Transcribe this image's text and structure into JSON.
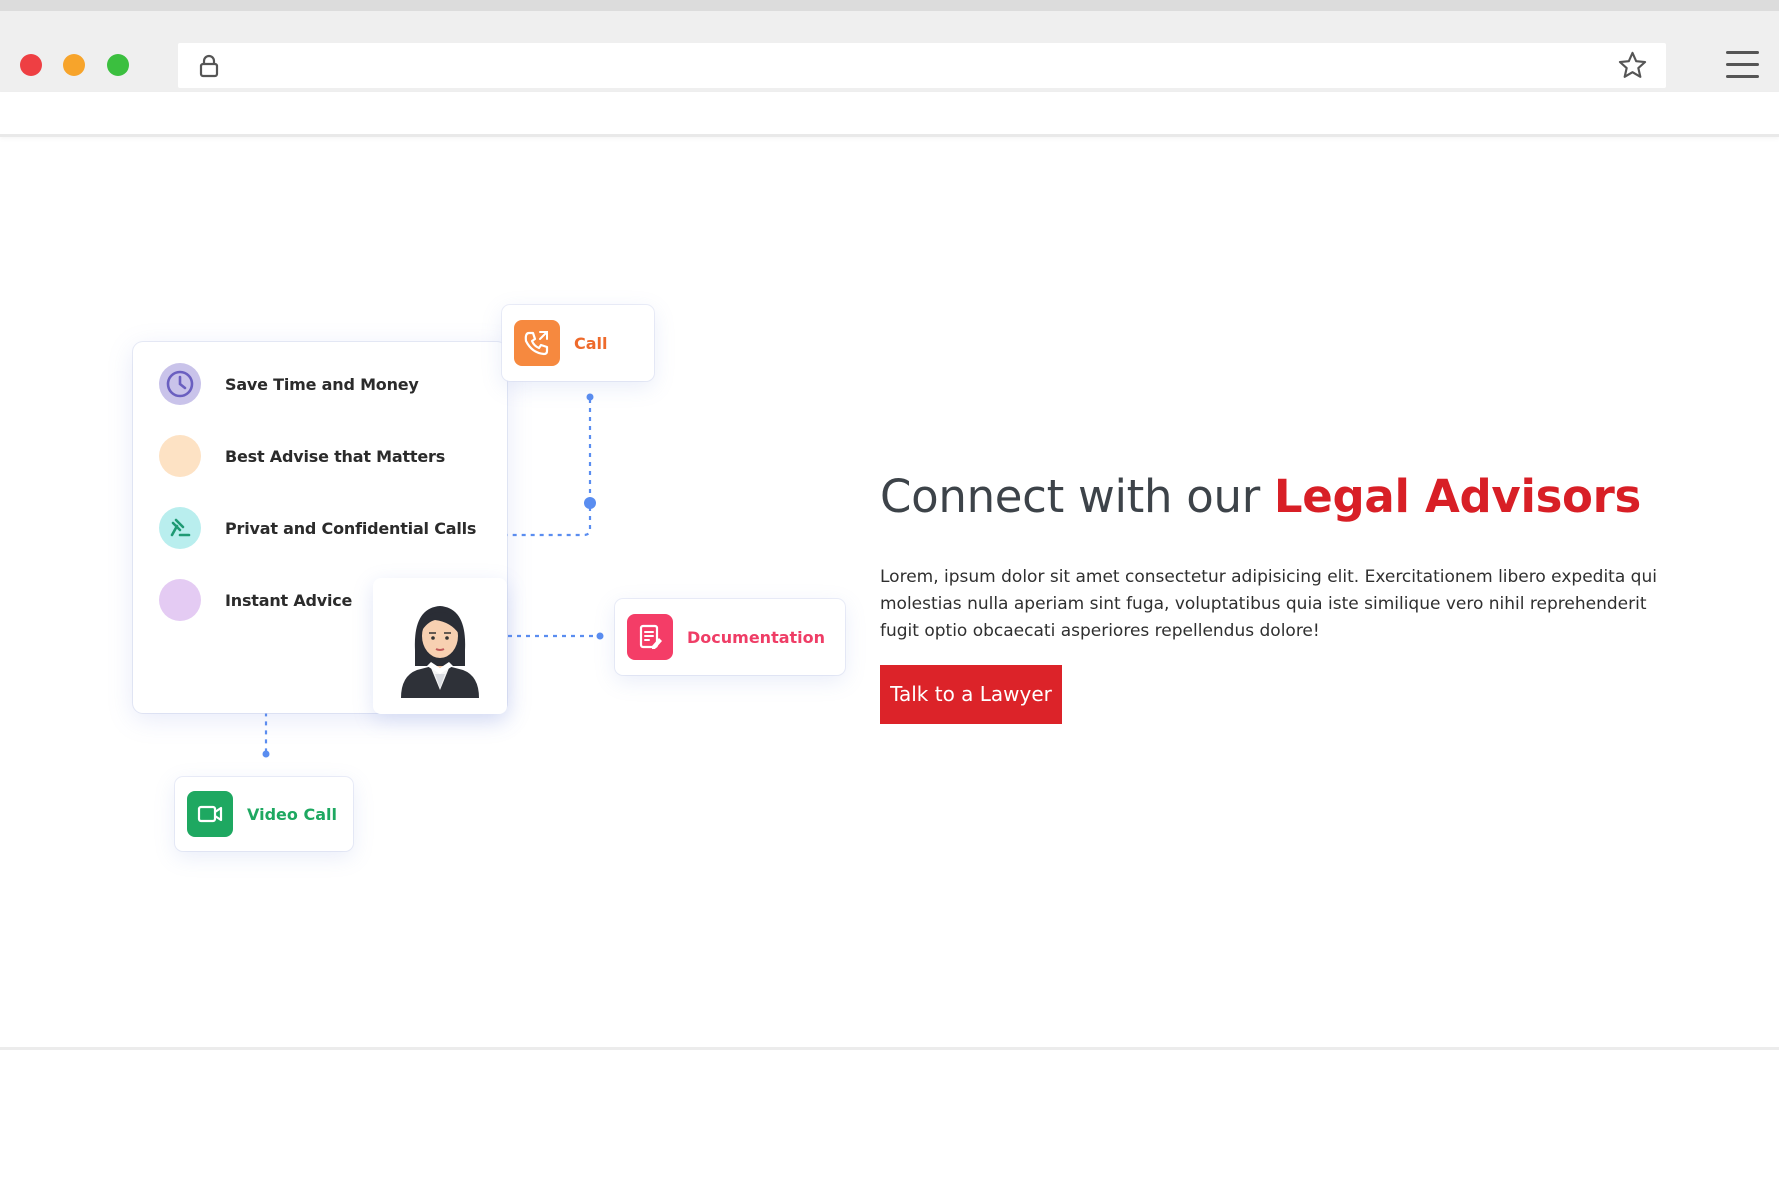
{
  "browser": {
    "url": "",
    "lock_icon": "lock-icon",
    "bookmark_icon": "star-icon",
    "menu_icon": "hamburger-menu-icon"
  },
  "features": [
    {
      "label": "Save Time and Money",
      "icon": "clock-icon",
      "color": "#c9c3ea"
    },
    {
      "label": "Best Advise that Matters",
      "icon": "circle",
      "color": "#fde2c4"
    },
    {
      "label": "Privat and Confidential Calls",
      "icon": "gavel-icon",
      "color": "#b9eeee"
    },
    {
      "label": "Instant Advice",
      "icon": "circle",
      "color": "#e4cbf3"
    }
  ],
  "actions": {
    "call": {
      "label": "Call",
      "icon": "phone-icon",
      "color": "#f6893f"
    },
    "documentation": {
      "label": "Documentation",
      "icon": "document-edit-icon",
      "color": "#f43d67"
    },
    "video_call": {
      "label": "Video Call",
      "icon": "video-camera-icon",
      "color": "#1ea861"
    }
  },
  "hero": {
    "title_plain": "Connect with our ",
    "title_accent": "Legal Advisors",
    "accent_color": "#d81f26",
    "description": "Lorem, ipsum dolor sit amet consectetur adipisicing elit. Exercitationem libero expedita qui molestias nulla aperiam sint fuga, voluptatibus quia iste similique vero nihil reprehenderit fugit optio obcaecati asperiores repellendus dolore!",
    "cta_label": "Talk to a Lawyer",
    "cta_color": "#dc2329"
  }
}
